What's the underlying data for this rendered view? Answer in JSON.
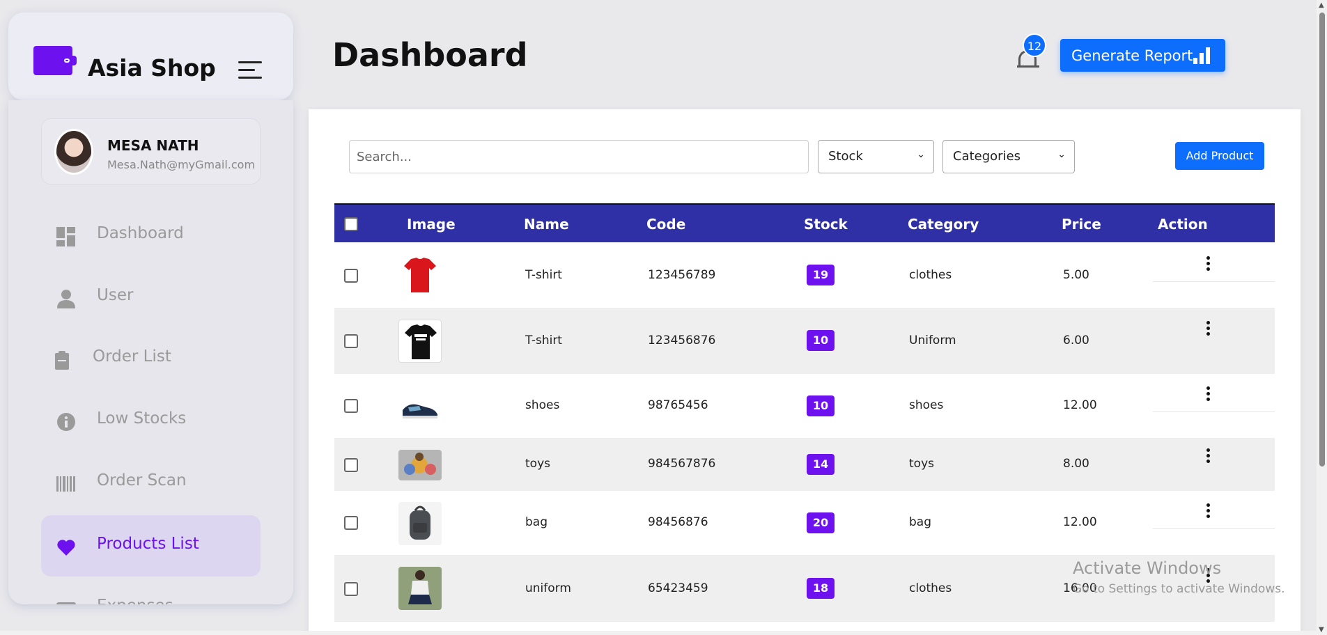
{
  "brand": {
    "name": "Asia Shop"
  },
  "profile": {
    "name": "MESA NATH",
    "email": "Mesa.Nath@myGmail.com"
  },
  "sidebar": {
    "items": [
      {
        "label": "Dashboard",
        "icon": "dashboard-icon"
      },
      {
        "label": "User",
        "icon": "user-icon"
      },
      {
        "label": "Order List",
        "icon": "clipboard-icon"
      },
      {
        "label": "Low Stocks",
        "icon": "info-icon"
      },
      {
        "label": "Order Scan",
        "icon": "barcode-icon"
      },
      {
        "label": "Products List",
        "icon": "heart-icon",
        "active": true
      },
      {
        "label": "Expenses",
        "icon": "wallet-icon"
      }
    ]
  },
  "header": {
    "title": "Dashboard",
    "notification_count": "12",
    "generate_report_label": "Generate Report"
  },
  "toolbar": {
    "search_placeholder": "Search...",
    "stock_select": "Stock",
    "categories_select": "Categories",
    "add_product_label": "Add Product"
  },
  "table": {
    "headers": [
      "Image",
      "Name",
      "Code",
      "Stock",
      "Category",
      "Price",
      "Action"
    ],
    "rows": [
      {
        "image": "red-tshirt",
        "name": "T-shirt",
        "code": "123456789",
        "stock": "19",
        "category": "clothes",
        "price": "5.00"
      },
      {
        "image": "black-tshirt",
        "name": "T-shirt",
        "code": "123456876",
        "stock": "10",
        "category": "Uniform",
        "price": "6.00"
      },
      {
        "image": "sneakers",
        "name": "shoes",
        "code": "98765456",
        "stock": "10",
        "category": "shoes",
        "price": "12.00"
      },
      {
        "image": "toys",
        "name": "toys",
        "code": "984567876",
        "stock": "14",
        "category": "toys",
        "price": "8.00"
      },
      {
        "image": "backpack",
        "name": "bag",
        "code": "98456876",
        "stock": "20",
        "category": "bag",
        "price": "12.00"
      },
      {
        "image": "school-uniform",
        "name": "uniform",
        "code": "65423459",
        "stock": "18",
        "category": "clothes",
        "price": "16.00"
      }
    ]
  },
  "watermark": {
    "line1": "Activate Windows",
    "line2": "Go to Settings to activate Windows."
  },
  "colors": {
    "accent": "#6d12ef",
    "primary": "#0d6efd",
    "table_header": "#2f2fa6"
  }
}
